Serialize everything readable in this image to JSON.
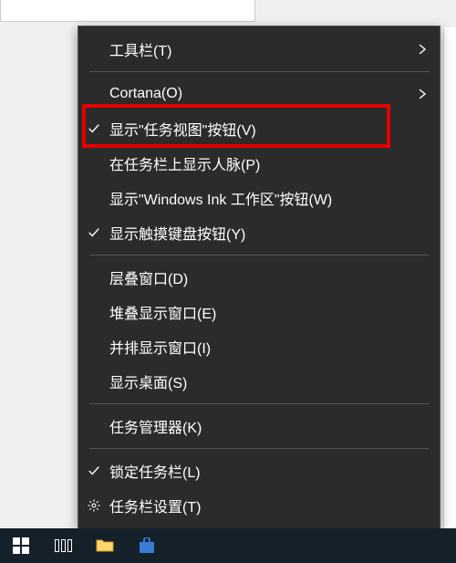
{
  "menu": {
    "items": [
      {
        "label": "工具栏(T)",
        "checked": false,
        "hasSubmenu": true,
        "icon": ""
      },
      {
        "separator": true
      },
      {
        "label": "Cortana(O)",
        "checked": false,
        "hasSubmenu": true,
        "icon": ""
      },
      {
        "label": "显示\"任务视图\"按钮(V)",
        "checked": true,
        "hasSubmenu": false,
        "icon": "",
        "highlighted": true
      },
      {
        "label": "在任务栏上显示人脉(P)",
        "checked": false,
        "hasSubmenu": false,
        "icon": ""
      },
      {
        "label": "显示\"Windows Ink 工作区\"按钮(W)",
        "checked": false,
        "hasSubmenu": false,
        "icon": ""
      },
      {
        "label": "显示触摸键盘按钮(Y)",
        "checked": true,
        "hasSubmenu": false,
        "icon": ""
      },
      {
        "separator": true
      },
      {
        "label": "层叠窗口(D)",
        "checked": false,
        "hasSubmenu": false,
        "icon": ""
      },
      {
        "label": "堆叠显示窗口(E)",
        "checked": false,
        "hasSubmenu": false,
        "icon": ""
      },
      {
        "label": "并排显示窗口(I)",
        "checked": false,
        "hasSubmenu": false,
        "icon": ""
      },
      {
        "label": "显示桌面(S)",
        "checked": false,
        "hasSubmenu": false,
        "icon": ""
      },
      {
        "separator": true
      },
      {
        "label": "任务管理器(K)",
        "checked": false,
        "hasSubmenu": false,
        "icon": ""
      },
      {
        "separator": true
      },
      {
        "label": "锁定任务栏(L)",
        "checked": true,
        "hasSubmenu": false,
        "icon": ""
      },
      {
        "label": "任务栏设置(T)",
        "checked": false,
        "hasSubmenu": false,
        "icon": "gear"
      }
    ]
  }
}
